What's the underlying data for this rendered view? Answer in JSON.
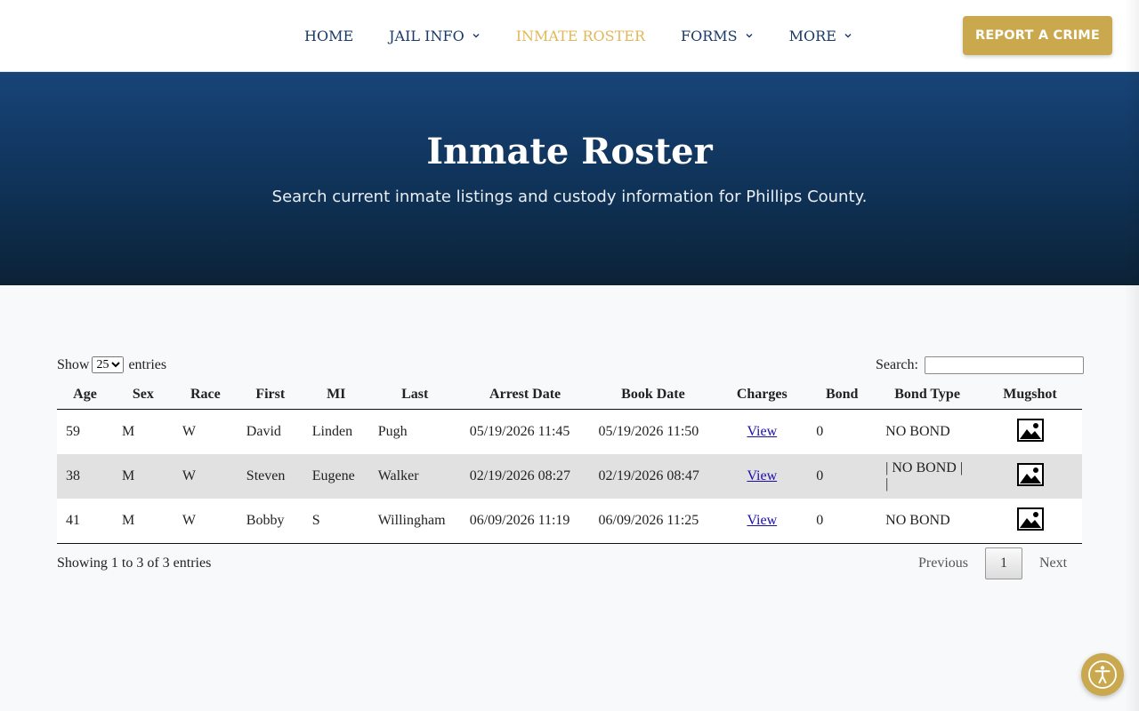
{
  "nav": {
    "items": [
      {
        "label": "HOME",
        "dropdown": false,
        "active": false
      },
      {
        "label": "JAIL INFO",
        "dropdown": true,
        "active": false
      },
      {
        "label": "INMATE ROSTER",
        "dropdown": false,
        "active": true
      },
      {
        "label": "FORMS",
        "dropdown": true,
        "active": false
      },
      {
        "label": "MORE",
        "dropdown": true,
        "active": false
      }
    ],
    "cta_label": "REPORT A CRIME"
  },
  "hero": {
    "title": "Inmate Roster",
    "subtitle": "Search current inmate listings and custody information for Phillips County."
  },
  "table_controls": {
    "show_label": "Show",
    "page_size": "25",
    "entries_label": "entries",
    "search_label": "Search:",
    "search_value": ""
  },
  "table": {
    "columns": [
      "Age",
      "Sex",
      "Race",
      "First",
      "MI",
      "Last",
      "Arrest Date",
      "Book Date",
      "Charges",
      "Bond",
      "Bond Type",
      "Mugshot"
    ],
    "rows": [
      {
        "age": "59",
        "sex": "M",
        "race": "W",
        "first": "David",
        "mi": "Linden",
        "last": "Pugh",
        "arrest_date": "05/19/2026 11:45",
        "book_date": "05/19/2026 11:50",
        "charges": "View",
        "bond": "0",
        "bond_type": "NO BOND",
        "mugshot_icon": "image-icon"
      },
      {
        "age": "38",
        "sex": "M",
        "race": "W",
        "first": "Steven",
        "mi": "Eugene",
        "last": "Walker",
        "arrest_date": "02/19/2026 08:27",
        "book_date": "02/19/2026 08:47",
        "charges": "View",
        "bond": "0",
        "bond_type": "| NO BOND | |",
        "mugshot_icon": "image-icon"
      },
      {
        "age": "41",
        "sex": "M",
        "race": "W",
        "first": "Bobby",
        "mi": "S",
        "last": "Willingham",
        "arrest_date": "06/09/2026 11:19",
        "book_date": "06/09/2026 11:25",
        "charges": "View",
        "bond": "0",
        "bond_type": "NO BOND",
        "mugshot_icon": "image-icon"
      }
    ]
  },
  "pagination": {
    "info": "Showing 1 to 3 of 3 entries",
    "previous": "Previous",
    "current_page": "1",
    "next": "Next"
  },
  "colors": {
    "nav_text": "#1a3a66",
    "nav_active": "#e0b85a",
    "accent_gold": "#c9a84e",
    "hero_top": "#174478",
    "hero_bottom": "#0b2236"
  },
  "accessibility": {
    "icon": "accessibility-icon"
  }
}
